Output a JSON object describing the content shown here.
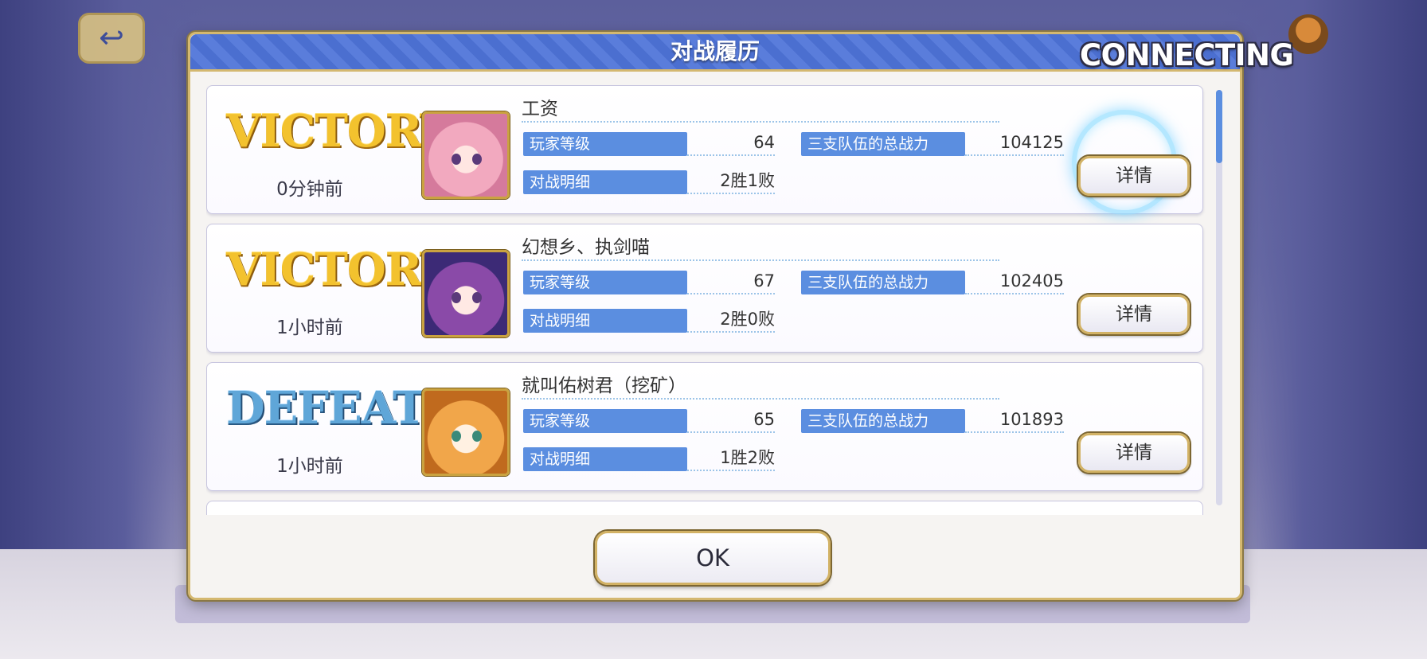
{
  "dialog": {
    "title": "对战履历",
    "ok_label": "OK"
  },
  "status": {
    "connecting": "CONNECTING"
  },
  "labels": {
    "player_level": "玩家等级",
    "battle_detail": "对战明细",
    "team_power": "三支队伍的总战力",
    "details_button": "详情"
  },
  "records": [
    {
      "result": "VICTORY",
      "time": "0分钟前",
      "name": "工资",
      "level": "64",
      "battle": "2胜1败",
      "power": "104125",
      "portrait_icon": "pink-hair-character-portrait"
    },
    {
      "result": "VICTORY",
      "time": "1小时前",
      "name": "幻想乡、执剑喵",
      "level": "67",
      "battle": "2胜0败",
      "power": "102405",
      "portrait_icon": "purple-hair-character-portrait"
    },
    {
      "result": "DEFEAT",
      "time": "1小时前",
      "name": "就叫佑树君（挖矿）",
      "level": "65",
      "battle": "1胜2败",
      "power": "101893",
      "portrait_icon": "orange-hair-character-portrait"
    }
  ],
  "colors": {
    "header_blue": "#4b6fd0",
    "label_blue": "#5b8ee0",
    "gold_border": "#d4b870",
    "victory_gold": "#f3c22e",
    "defeat_blue": "#5fa6d8"
  }
}
